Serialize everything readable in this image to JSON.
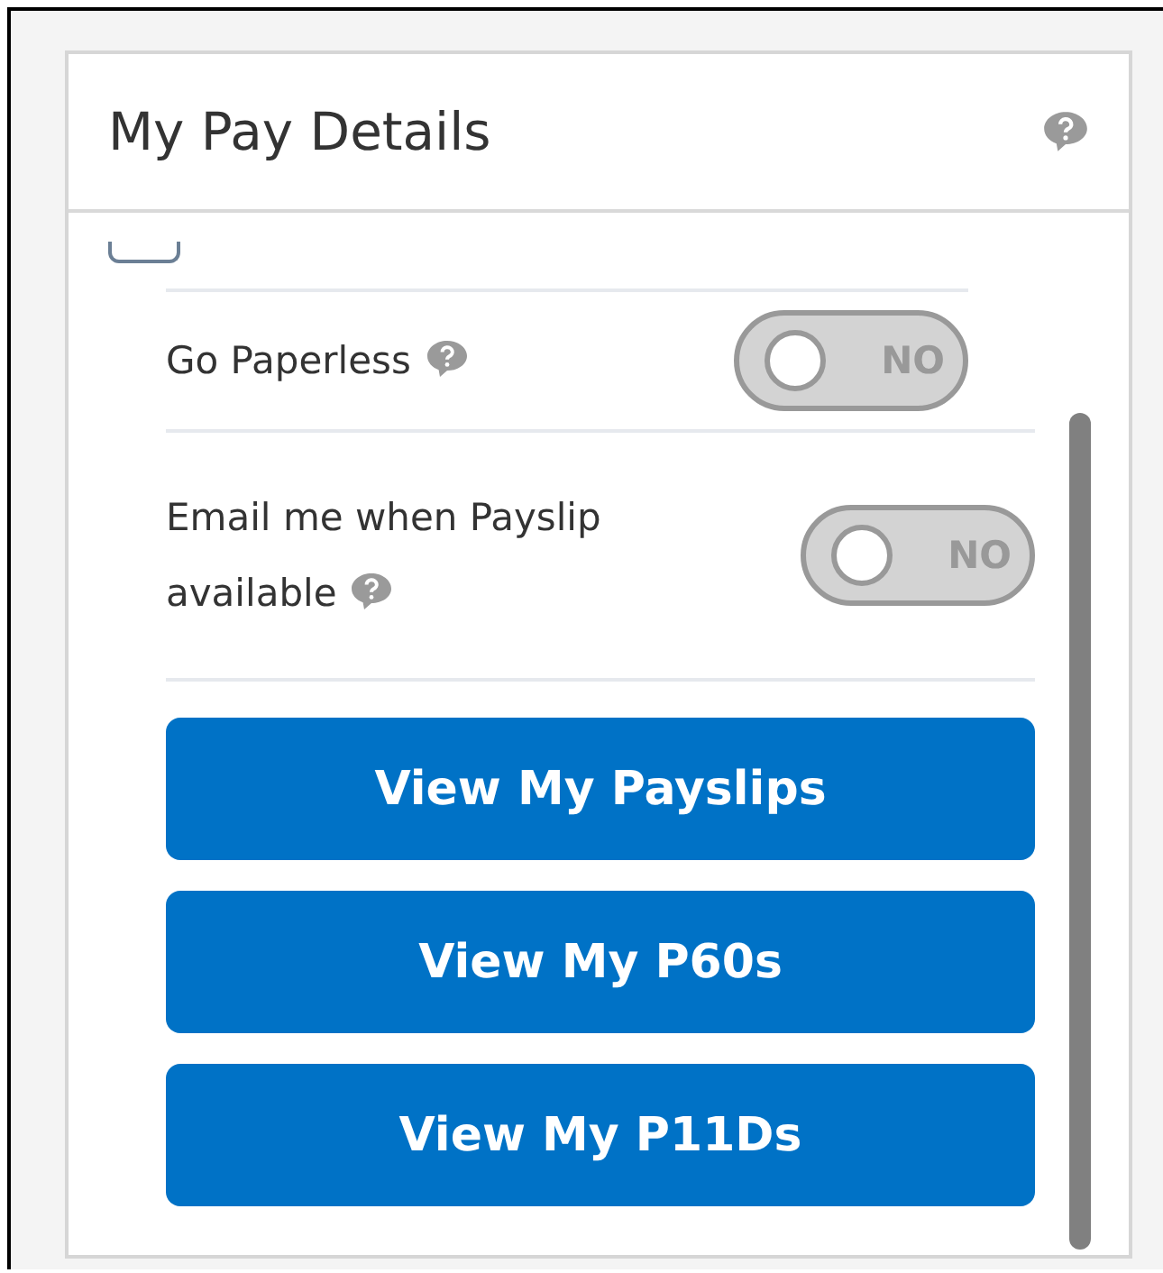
{
  "panel": {
    "title": "My Pay Details"
  },
  "settings": [
    {
      "label": "Go Paperless",
      "toggle_text": "NO",
      "on": false
    },
    {
      "label": "Email me when Payslip available",
      "toggle_text": "NO",
      "on": false
    }
  ],
  "buttons": [
    "View My Payslips",
    "View My P60s",
    "View My P11Ds"
  ]
}
